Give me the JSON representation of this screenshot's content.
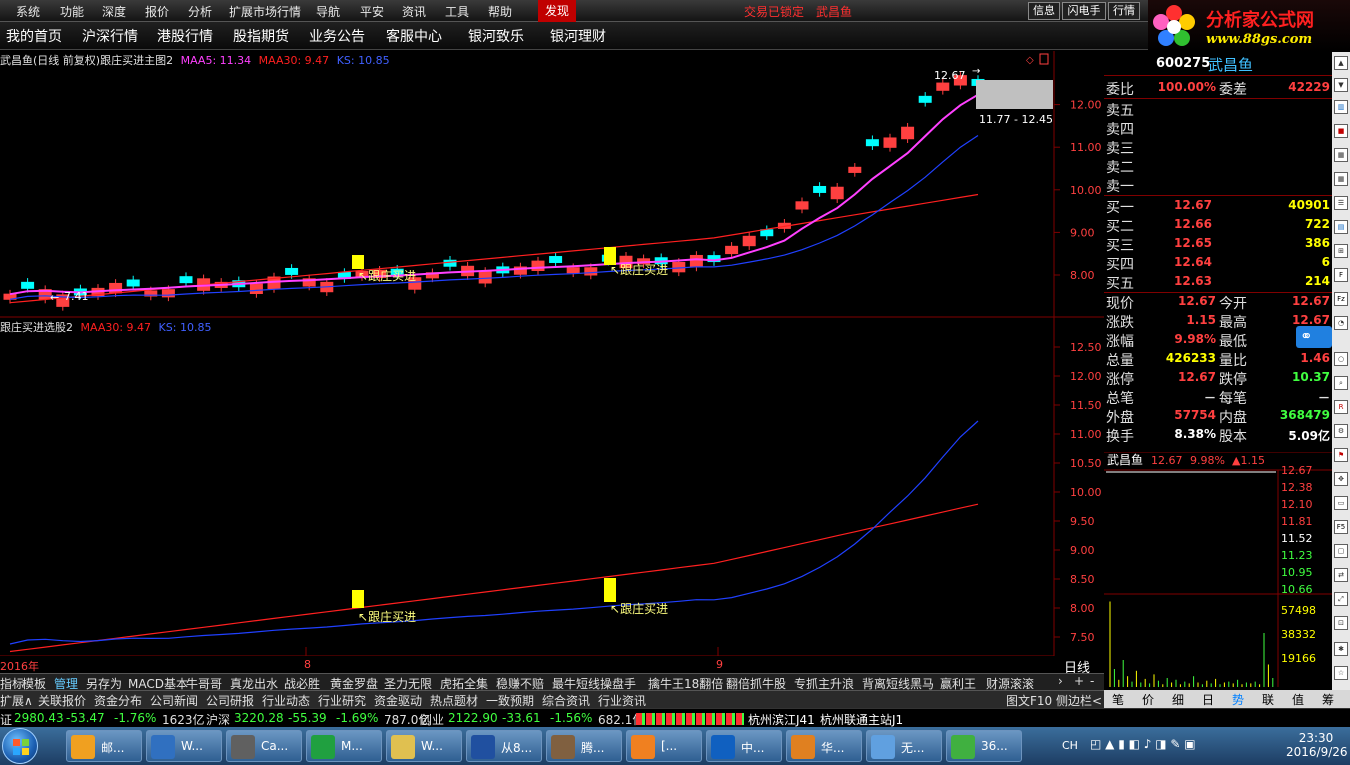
{
  "menubar": {
    "items": [
      "系统",
      "功能",
      "深度",
      "报价",
      "分析",
      "扩展市场行情",
      "导航",
      "平安",
      "资讯",
      "工具",
      "帮助"
    ],
    "discover": "发现",
    "lock_status": "交易已锁定",
    "stock_name": "武昌鱼",
    "right_buttons": [
      "信息",
      "闪电手",
      "行情"
    ]
  },
  "logo": {
    "line1": "分析家公式网",
    "line2": "www.88gs.com"
  },
  "navbar": {
    "items": [
      "我的首页",
      "沪深行情",
      "港股行情",
      "股指期货",
      "业务公告",
      "客服中心",
      "银河致乐",
      "银河理财"
    ]
  },
  "main_chart": {
    "title": "武昌鱼(日线 前复权)",
    "indicator": "跟庄买进主图2",
    "maa5_label": "MAA5: 11.34",
    "maa30_label": "MAA30: 9.47",
    "ks_label": "KS: 10.85",
    "high_label": "12.67",
    "range_label": "11.77 - 12.45",
    "low_label": "7.41",
    "signal_label": "跟庄买进",
    "y_ticks": [
      "12.00",
      "11.00",
      "10.00",
      "9.00",
      "8.00"
    ],
    "colors": {
      "up": "#ff4040",
      "down": "#00ffff",
      "ma5": "#ff40ff",
      "ks": "#2040ff",
      "ma30": "#ff2020",
      "signal": "#ffff00"
    }
  },
  "sub_chart": {
    "title": "跟庄买进选股2",
    "maa30_label": "MAA30: 9.47",
    "ks_label": "KS: 10.85",
    "signal_label": "跟庄买进",
    "y_ticks": [
      "12.50",
      "12.00",
      "11.50",
      "11.00",
      "10.50",
      "10.00",
      "9.50",
      "9.00",
      "8.50",
      "8.00",
      "7.50"
    ]
  },
  "x_axis": {
    "labels": [
      "2016年",
      "8",
      "9"
    ],
    "period": "日线"
  },
  "quote": {
    "code": "600275",
    "name": "武昌鱼",
    "weibi_label": "委比",
    "weibi": "100.00%",
    "weicha_label": "委差",
    "weicha": "42229",
    "sells": [
      {
        "label": "卖五",
        "price": "",
        "vol": ""
      },
      {
        "label": "卖四",
        "price": "",
        "vol": ""
      },
      {
        "label": "卖三",
        "price": "",
        "vol": ""
      },
      {
        "label": "卖二",
        "price": "",
        "vol": ""
      },
      {
        "label": "卖一",
        "price": "",
        "vol": ""
      }
    ],
    "buys": [
      {
        "label": "买一",
        "price": "12.67",
        "vol": "40901"
      },
      {
        "label": "买二",
        "price": "12.66",
        "vol": "722"
      },
      {
        "label": "买三",
        "price": "12.65",
        "vol": "386"
      },
      {
        "label": "买四",
        "price": "12.64",
        "vol": "6"
      },
      {
        "label": "买五",
        "price": "12.63",
        "vol": "214"
      }
    ],
    "stats": [
      {
        "l1": "现价",
        "v1": "12.67",
        "l2": "今开",
        "v2": "12.67",
        "c1": "#ff4040",
        "c2": "#ff4040"
      },
      {
        "l1": "涨跌",
        "v1": "1.15",
        "l2": "最高",
        "v2": "12.67",
        "c1": "#ff4040",
        "c2": "#ff4040"
      },
      {
        "l1": "涨幅",
        "v1": "9.98%",
        "l2": "最低",
        "v2": "",
        "c1": "#ff4040",
        "c2": "#ff4040"
      },
      {
        "l1": "总量",
        "v1": "426233",
        "l2": "量比",
        "v2": "1.46",
        "c1": "#ffff00",
        "c2": "#ff4040"
      },
      {
        "l1": "涨停",
        "v1": "12.67",
        "l2": "跌停",
        "v2": "10.37",
        "c1": "#ff4040",
        "c2": "#40ff40"
      },
      {
        "l1": "总笔",
        "v1": "－",
        "l2": "每笔",
        "v2": "－",
        "c1": "#e0e0e0",
        "c2": "#e0e0e0"
      },
      {
        "l1": "外盘",
        "v1": "57754",
        "l2": "内盘",
        "v2": "368479",
        "c1": "#ff4040",
        "c2": "#40ff40"
      },
      {
        "l1": "换手",
        "v1": "8.38%",
        "l2": "股本",
        "v2": "5.09亿",
        "c1": "#ffffff",
        "c2": "#ffffff"
      }
    ]
  },
  "mini_chart": {
    "name": "武昌鱼",
    "price": "12.67",
    "pct": "9.98%",
    "chg": "▲1.15",
    "price_ticks": [
      "12.67",
      "12.38",
      "12.10",
      "11.81",
      "11.52",
      "11.23",
      "10.95",
      "10.66"
    ],
    "vol_ticks": [
      "57498",
      "38332",
      "19166"
    ]
  },
  "bottom_tabs": [
    "指标",
    "模板",
    "管理",
    "另存为",
    "MACD基本",
    "牛哥哥",
    "真龙出水",
    "战必胜",
    "黄金罗盘",
    "圣力无限",
    "虎拓全集",
    "稳赚不赔",
    "最牛短线操盘手",
    "擒牛王18翻倍",
    "翻倍抓牛股",
    "专抓主升浪",
    "背离短线黑马",
    "赢利王",
    "财源滚滚"
  ],
  "bottom_tabs2": [
    "扩展∧",
    "关联报价",
    "资金分布",
    "公司新闻",
    "公司研报",
    "行业动态",
    "行业研究",
    "资金驱动",
    "热点题材",
    "一致预期",
    "综合资讯",
    "行业资讯"
  ],
  "bottom_tabs2_right": [
    "图文F10",
    "侧边栏<"
  ],
  "right_tabs": [
    "笔",
    "价",
    "细",
    "日",
    "势",
    "联",
    "值",
    "筹"
  ],
  "index_bar": [
    {
      "name": "证",
      "val": "2980.43",
      "chg": "-53.47",
      "pct": "-1.76%",
      "amt": "1623亿"
    },
    {
      "name": "沪深",
      "val": "3220.28",
      "chg": "-55.39",
      "pct": "-1.69%",
      "amt": "787.0亿"
    },
    {
      "name": "创业",
      "val": "2122.90",
      "chg": "-33.61",
      "pct": "-1.56%",
      "amt": "682.1亿"
    }
  ],
  "index_bar_sites": [
    "杭州滨江J41",
    "杭州联通主站J1"
  ],
  "taskbar": {
    "tasks": [
      "邮...",
      "W...",
      "Ca...",
      "M...",
      "W...",
      "从8...",
      "腾...",
      "[...",
      "中...",
      "华...",
      "无...",
      "36..."
    ],
    "lang": "CH",
    "time": "23:30",
    "date": "2016/9/26"
  }
}
